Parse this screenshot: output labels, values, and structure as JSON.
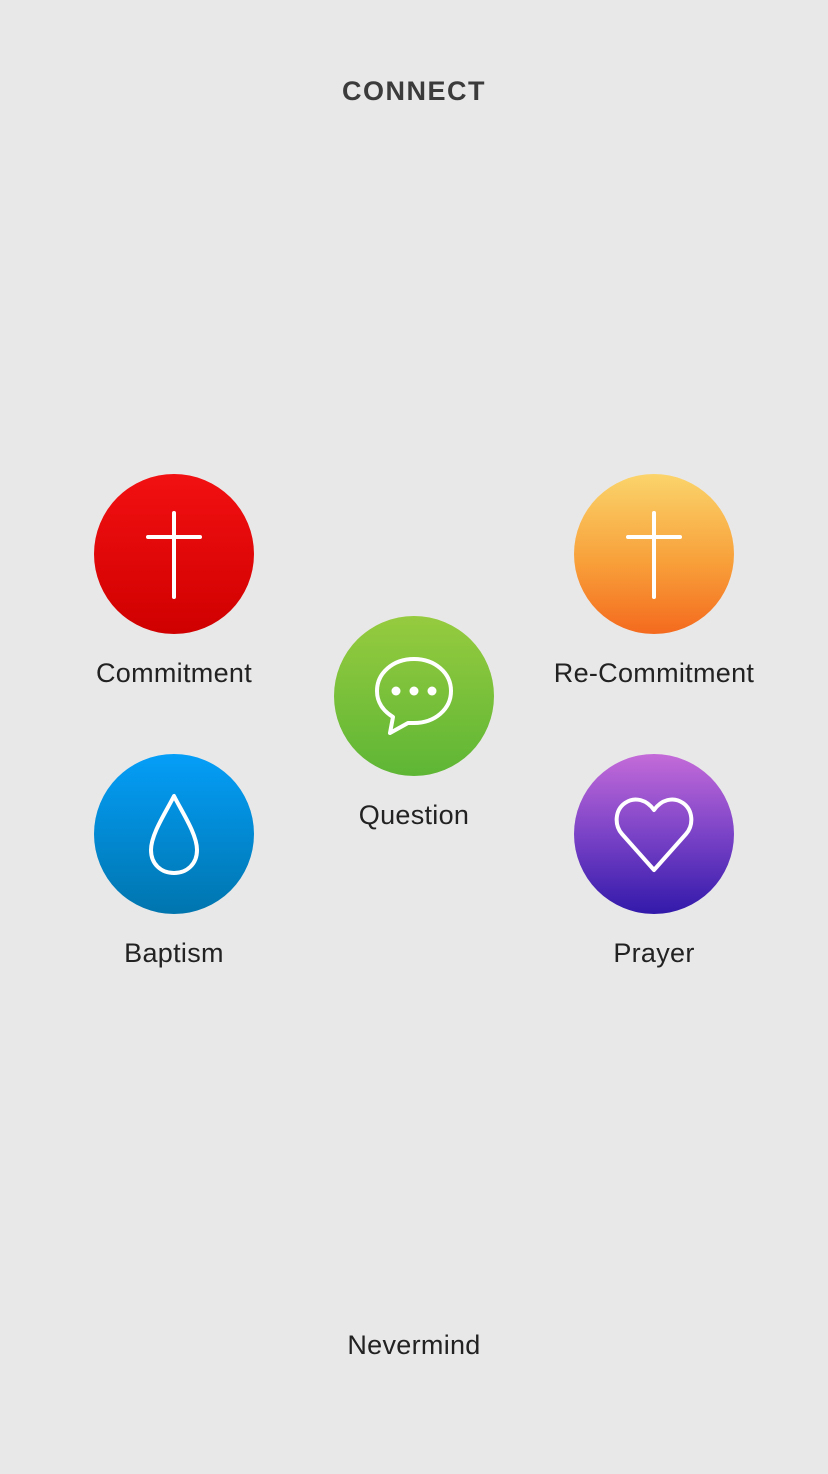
{
  "header": {
    "title": "CONNECT"
  },
  "actions": [
    {
      "label": "Commitment",
      "icon": "cross-icon",
      "color": "#e00808"
    },
    {
      "label": "Re-Commitment",
      "icon": "cross-icon",
      "color": "#f7942f"
    },
    {
      "label": "Question",
      "icon": "chat-bubble-icon",
      "color": "#7cc13a"
    },
    {
      "label": "Baptism",
      "icon": "water-drop-icon",
      "color": "#028bd3"
    },
    {
      "label": "Prayer",
      "icon": "heart-icon",
      "color": "#7a3fc6"
    }
  ],
  "footer": {
    "cancel_label": "Nevermind"
  }
}
